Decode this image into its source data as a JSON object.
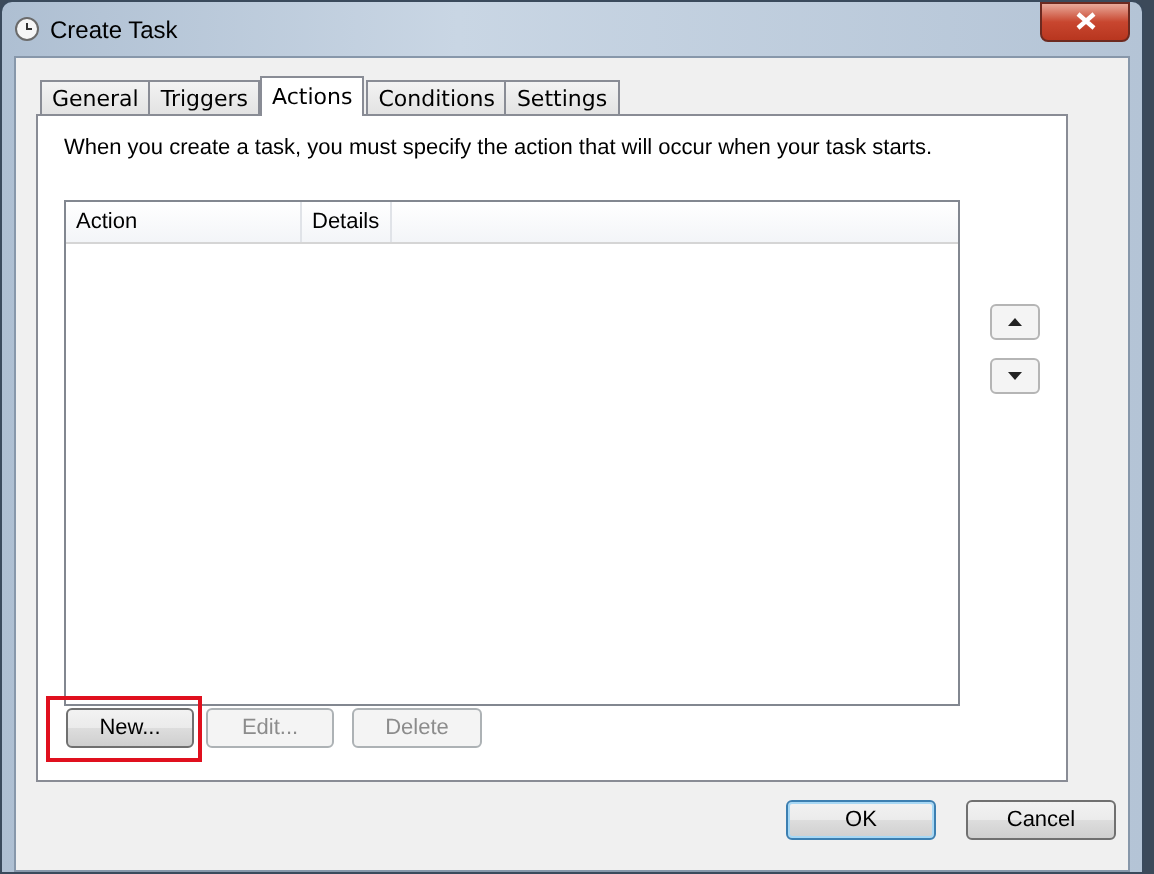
{
  "window": {
    "title": "Create Task"
  },
  "tabs": [
    {
      "label": "General",
      "selected": false
    },
    {
      "label": "Triggers",
      "selected": false
    },
    {
      "label": "Actions",
      "selected": true
    },
    {
      "label": "Conditions",
      "selected": false
    },
    {
      "label": "Settings",
      "selected": false
    }
  ],
  "description": "When you create a task, you must specify the action that will occur when your task starts.",
  "list": {
    "columns": [
      "Action",
      "Details"
    ]
  },
  "action_buttons": [
    {
      "label": "New...",
      "disabled": false,
      "highlighted": true
    },
    {
      "label": "Edit...",
      "disabled": true,
      "highlighted": false
    },
    {
      "label": "Delete",
      "disabled": true,
      "highlighted": false
    }
  ],
  "dialog_buttons": [
    {
      "label": "OK",
      "default": true
    },
    {
      "label": "Cancel",
      "default": false
    }
  ]
}
